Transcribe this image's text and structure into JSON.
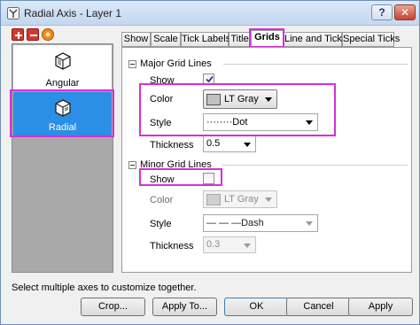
{
  "window": {
    "title": "Radial Axis - Layer 1",
    "help_label": "?",
    "close_label": "✕"
  },
  "toolbar": {
    "plus_icon": "plus-icon",
    "minus_icon": "minus-icon",
    "options_icon": "orange-circle-icon"
  },
  "axes_list": {
    "items": [
      {
        "label": "Angular",
        "icon": "angular-axis-icon",
        "selected": false
      },
      {
        "label": "Radial",
        "icon": "radial-axis-icon",
        "selected": true
      }
    ]
  },
  "tabs": [
    {
      "label": "Show",
      "active": false
    },
    {
      "label": "Scale",
      "active": false
    },
    {
      "label": "Tick Labels",
      "active": false
    },
    {
      "label": "Title",
      "active": false
    },
    {
      "label": "Grids",
      "active": true
    },
    {
      "label": "Line and Ticks",
      "active": false
    },
    {
      "label": "Special Ticks",
      "active": false
    }
  ],
  "major": {
    "header": "Major Grid Lines",
    "show_label": "Show",
    "show_checked": true,
    "color_label": "Color",
    "color_value": "LT Gray",
    "style_label": "Style",
    "style_value": "········Dot",
    "thickness_label": "Thickness",
    "thickness_value": "0.5"
  },
  "minor": {
    "header": "Minor Grid Lines",
    "show_label": "Show",
    "show_checked": false,
    "color_label": "Color",
    "color_value": "LT Gray",
    "style_label": "Style",
    "style_value": "— — —Dash",
    "thickness_label": "Thickness",
    "thickness_value": "0.3"
  },
  "status_text": "Select multiple axes to customize together.",
  "buttons": {
    "crop": "Crop...",
    "apply_to": "Apply To...",
    "ok": "OK",
    "cancel": "Cancel",
    "apply": "Apply"
  },
  "colors": {
    "highlight": "#d62fd6",
    "selected_item": "#2a8fe5",
    "swatch_lt_gray": "#c0c0c0"
  }
}
